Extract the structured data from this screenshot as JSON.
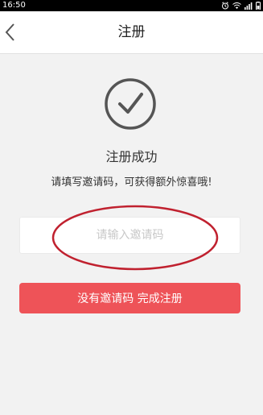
{
  "status_bar": {
    "time": "16:50",
    "icons": [
      "alarm-icon",
      "wifi-icon",
      "signal-icon",
      "battery-icon"
    ]
  },
  "nav": {
    "title": "注册",
    "back_icon": "chevron-left-icon"
  },
  "success": {
    "icon": "check-circle-icon",
    "title": "注册成功",
    "subtitle": "请填写邀请码，可获得额外惊喜哦!"
  },
  "invite": {
    "placeholder": "请输入邀请码",
    "value": ""
  },
  "actions": {
    "complete_label": "没有邀请码  完成注册"
  },
  "colors": {
    "accent": "#ee5358",
    "annotation": "#c0212f",
    "background": "#f2f2f2"
  }
}
